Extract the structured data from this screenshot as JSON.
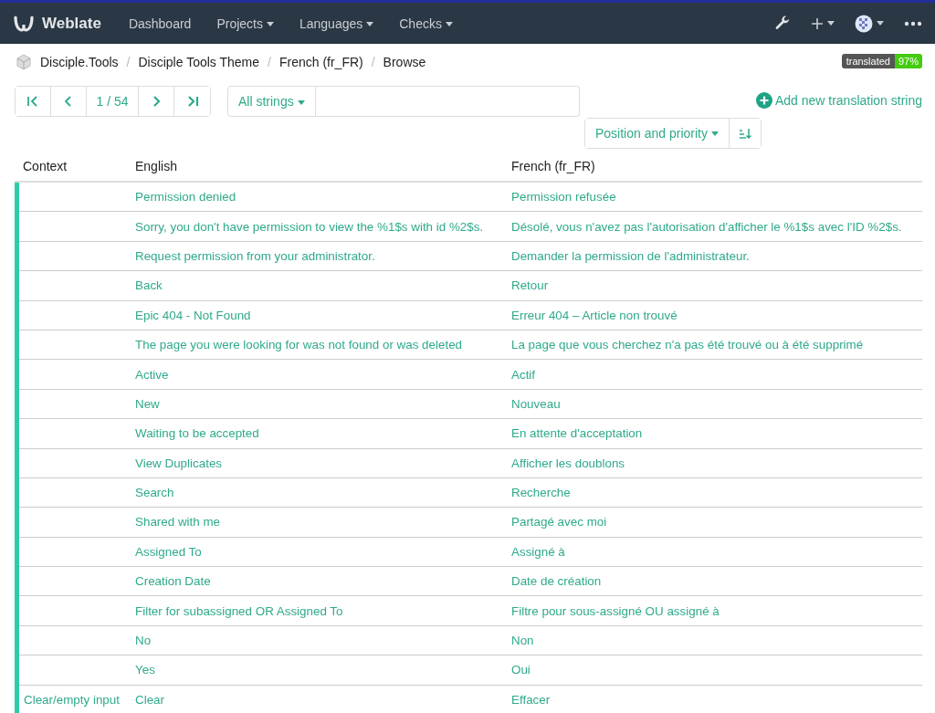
{
  "navbar": {
    "brand": "Weblate",
    "menu": [
      {
        "label": "Dashboard",
        "dropdown": false
      },
      {
        "label": "Projects",
        "dropdown": true
      },
      {
        "label": "Languages",
        "dropdown": true
      },
      {
        "label": "Checks",
        "dropdown": true
      }
    ]
  },
  "breadcrumbs": [
    {
      "label": "Disciple.Tools"
    },
    {
      "separator": "/",
      "label": "Disciple Tools Theme"
    },
    {
      "separator": "/",
      "label": "French (fr_FR)"
    },
    {
      "separator": "/",
      "label": "Browse"
    }
  ],
  "badge": {
    "label": "translated",
    "value": "97%"
  },
  "pager": {
    "position": "1 / 54"
  },
  "filter": {
    "label": "All strings"
  },
  "add_string": {
    "label": "Add new translation string"
  },
  "sort": {
    "label": "Position and priority"
  },
  "table": {
    "columns": [
      "Context",
      "English",
      "French (fr_FR)"
    ],
    "rows": [
      {
        "color": "#2eccaa",
        "context": "",
        "source": "Permission denied",
        "target": "Permission refusée"
      },
      {
        "color": "#2eccaa",
        "context": "",
        "source": "Sorry, you don't have permission to view the %1$s with id %2$s.",
        "target": "Désolé, vous n'avez pas l'autorisation d'afficher le %1$s avec l'ID %2$s."
      },
      {
        "color": "#2eccaa",
        "context": "",
        "source": "Request permission from your administrator.",
        "target": "Demander la permission de l'administrateur."
      },
      {
        "color": "#2eccaa",
        "context": "",
        "source": "Back",
        "target": "Retour"
      },
      {
        "color": "#2eccaa",
        "context": "",
        "source": "Epic 404 - Not Found",
        "target": "Erreur 404 – Article non trouvé"
      },
      {
        "color": "#2eccaa",
        "context": "",
        "source": "The page you were looking for was not found or was deleted",
        "target": "La page que vous cherchez n'a pas été trouvé ou à été supprimé"
      },
      {
        "color": "#2eccaa",
        "context": "",
        "source": "Active",
        "target": "Actif"
      },
      {
        "color": "#2eccaa",
        "context": "",
        "source": "New",
        "target": "Nouveau"
      },
      {
        "color": "#2eccaa",
        "context": "",
        "source": "Waiting to be accepted",
        "target": "En attente d'acceptation"
      },
      {
        "color": "#2eccaa",
        "context": "",
        "source": "View Duplicates",
        "target": "Afficher les doublons"
      },
      {
        "color": "#2eccaa",
        "context": "",
        "source": "Search",
        "target": "Recherche"
      },
      {
        "color": "#2eccaa",
        "context": "",
        "source": "Shared with me",
        "target": "Partagé avec moi"
      },
      {
        "color": "#2eccaa",
        "context": "",
        "source": "Assigned To",
        "target": "Assigné à"
      },
      {
        "color": "#2eccaa",
        "context": "",
        "source": "Creation Date",
        "target": "Date de création"
      },
      {
        "color": "#2eccaa",
        "context": "",
        "source": "Filter for subassigned OR Assigned To",
        "target": "Filtre pour sous-assigné OU assigné à"
      },
      {
        "color": "#2eccaa",
        "context": "",
        "source": "No",
        "target": "Non"
      },
      {
        "color": "#2eccaa",
        "context": "",
        "source": "Yes",
        "target": "Oui"
      },
      {
        "color": "#2eccaa",
        "context": "Clear/empty input",
        "source": "Clear",
        "target": "Effacer"
      }
    ]
  }
}
